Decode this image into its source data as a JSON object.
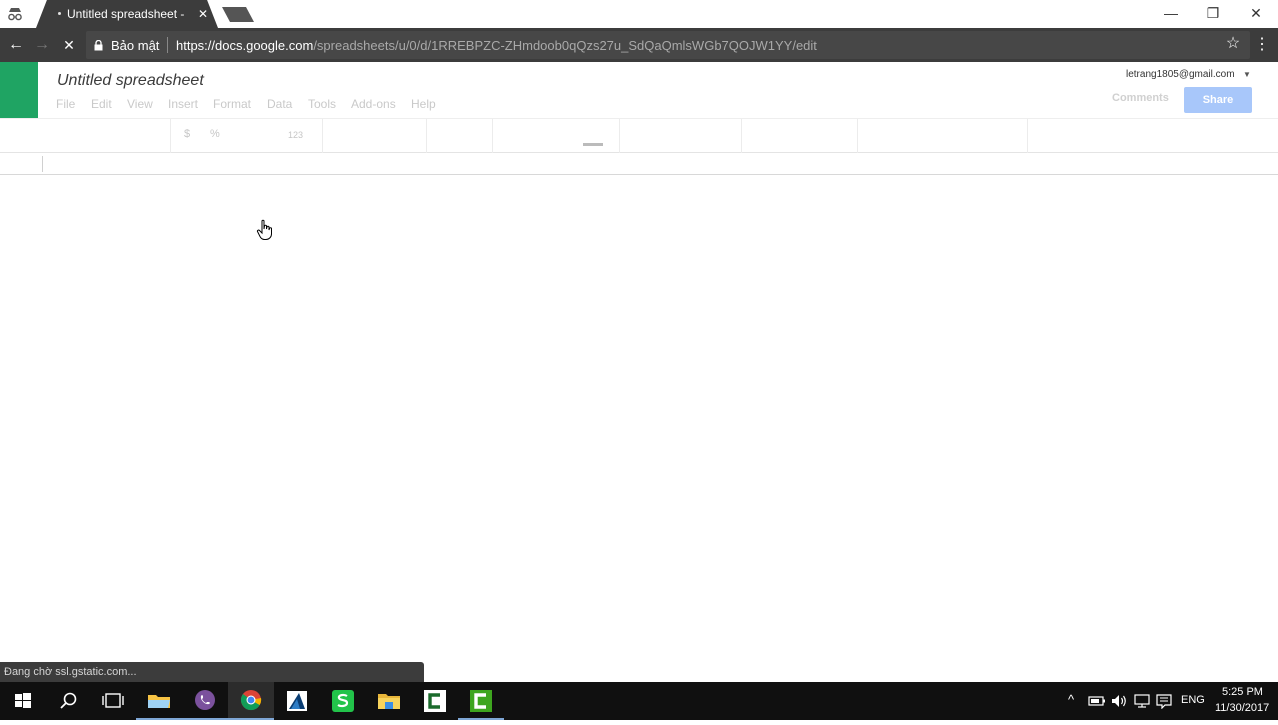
{
  "browser": {
    "tab": {
      "title": "Untitled spreadsheet - G",
      "close_glyph": "✕"
    },
    "window_controls": {
      "minimize": "—",
      "restore": "❐",
      "close": "✕"
    },
    "nav": {
      "back": "←",
      "forward": "→",
      "stop": "✕"
    },
    "address": {
      "security_label": "Bảo mật",
      "url_host": "https://docs.google.com",
      "url_path": "/spreadsheets/u/0/d/1RREBPZC-ZHmdoob0qQzs27u_SdQaQmlsWGb7QOJW1YY/edit"
    },
    "bookmark_glyph": "☆",
    "menu_glyph": "⋮",
    "status_text": "Đang chờ ssl.gstatic.com..."
  },
  "sheets": {
    "title": "Untitled spreadsheet",
    "menu": [
      "File",
      "Edit",
      "View",
      "Insert",
      "Format",
      "Data",
      "Tools",
      "Add-ons",
      "Help"
    ],
    "account": "letrang1805@gmail.com",
    "account_caret": "▼",
    "comments_label": "Comments",
    "share_label": "Share",
    "format_toolbar": {
      "currency": "$",
      "percent": "%",
      "more_formats": "123"
    }
  },
  "taskbar": {
    "apps": [
      "start-icon",
      "search-icon",
      "task-view-icon",
      "file-explorer-icon",
      "viber-icon",
      "chrome-icon",
      "app-icon",
      "sheets-green-icon",
      "folder-icon",
      "camtasia-icon",
      "camtasia-recorder-icon"
    ],
    "active_app": "chrome-icon",
    "tray": {
      "caret": "^",
      "language": "ENG",
      "time": "5:25 PM",
      "date": "11/30/2017"
    }
  },
  "colors": {
    "sheets_green": "#1fa463",
    "share_button": "#a8c7fa",
    "chrome_dark": "#3c3c3c",
    "taskbar": "#101010"
  }
}
